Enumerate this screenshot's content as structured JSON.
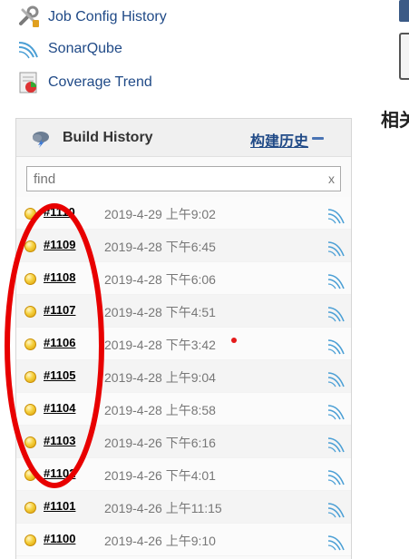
{
  "side_links": [
    {
      "label": "Job Config History",
      "icon": "job-config-history-icon"
    },
    {
      "label": "SonarQube",
      "icon": "sonarqube-icon"
    },
    {
      "label": "Coverage Trend",
      "icon": "coverage-trend-icon"
    }
  ],
  "right_fragment": {
    "title": "相关"
  },
  "build_history": {
    "title": "Build History",
    "trend_label": "构建历史",
    "search_placeholder": "find",
    "search_clear": "x",
    "builds": [
      {
        "number": "#1110",
        "time": "2019-4-29 上午9:02"
      },
      {
        "number": "#1109",
        "time": "2019-4-28 下午6:45"
      },
      {
        "number": "#1108",
        "time": "2019-4-28 下午6:06"
      },
      {
        "number": "#1107",
        "time": "2019-4-28 下午4:51"
      },
      {
        "number": "#1106",
        "time": "2019-4-28 下午3:42"
      },
      {
        "number": "#1105",
        "time": "2019-4-28 上午9:04"
      },
      {
        "number": "#1104",
        "time": "2019-4-28 上午8:58"
      },
      {
        "number": "#1103",
        "time": "2019-4-26 下午6:16"
      },
      {
        "number": "#1102",
        "time": "2019-4-26 下午4:01"
      },
      {
        "number": "#1101",
        "time": "2019-4-26 上午11:15"
      },
      {
        "number": "#1100",
        "time": "2019-4-26 上午9:10"
      }
    ]
  },
  "colors": {
    "link": "#204a87",
    "ball": "#f5d03d",
    "annotation": "#e80000"
  }
}
